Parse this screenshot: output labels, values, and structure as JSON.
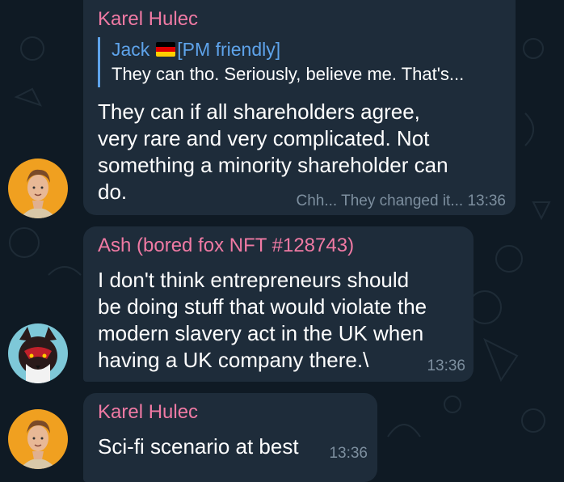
{
  "messages": [
    {
      "sender": "Karel Hulec",
      "reply": {
        "name": "Jack",
        "flag": "germany-flag",
        "name_suffix": "[PM friendly]",
        "text": "They can tho. Seriously, believe me. That's..."
      },
      "lines": [
        "They can if all shareholders agree,",
        "very rare and very complicated. Not",
        "something a minority shareholder can",
        "do."
      ],
      "edited_by": "Chh... They changed it...",
      "time": "13:36"
    },
    {
      "sender": "Ash (bored fox NFT #128743)",
      "lines": [
        "I don't think entrepreneurs should",
        "be doing stuff that would violate the",
        "modern slavery act in the UK when",
        "having a UK company there.\\"
      ],
      "time": "13:36"
    },
    {
      "sender": "Karel Hulec",
      "lines": [
        "Sci-fi scenario at best"
      ],
      "time": "13:36"
    }
  ],
  "colors": {
    "background": "#0f1a24",
    "bubble": "#1e2c3a",
    "sender_name": "#f07aa4",
    "reply_accent": "#5ea3ea",
    "meta_text": "#7d8f9f"
  }
}
